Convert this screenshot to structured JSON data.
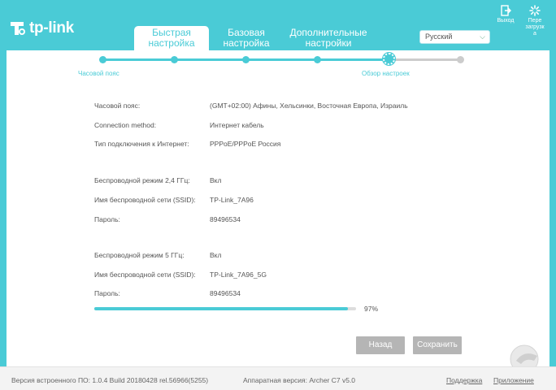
{
  "header": {
    "brand": "tp-link",
    "tabs": [
      {
        "label_line1": "Быстрая",
        "label_line2": "настройка",
        "active": true
      },
      {
        "label_line1": "Базовая",
        "label_line2": "настройка",
        "active": false
      },
      {
        "label_line1": "Дополнительные",
        "label_line2": "настройки",
        "active": false
      }
    ],
    "language": "Русский",
    "logout_label": "Выход",
    "reboot_label_1": "Пере",
    "reboot_label_2": "загрузк",
    "reboot_label_3": "а"
  },
  "wizard": {
    "step_label_first": "Часовой пояс",
    "step_label_current": "Обзор настроек",
    "steps_total": 6,
    "current_step": 5
  },
  "summary": {
    "rows": [
      {
        "label": "Часовой пояс:",
        "value": "(GMT+02:00) Афины, Хельсинки, Восточная Европа, Израиль"
      },
      {
        "label": "Connection method:",
        "value": "Интернет кабель"
      },
      {
        "label": "Тип подключения к Интернет:",
        "value": "PPPoE/PPPoE Россия"
      },
      {
        "label": "Беспроводной режим 2,4 ГГц:",
        "value": "Вкл"
      },
      {
        "label": "Имя беспроводной сети (SSID):",
        "value": "TP-Link_7A96"
      },
      {
        "label": "Пароль:",
        "value": "89496534"
      },
      {
        "label": "Беспроводной режим 5 ГГц:",
        "value": "Вкл"
      },
      {
        "label": "Имя беспроводной сети (SSID):",
        "value": "TP-Link_7A96_5G"
      },
      {
        "label": "Пароль:",
        "value": "89496534"
      }
    ]
  },
  "progress": {
    "value": 0.97,
    "label": "97%"
  },
  "buttons": {
    "back": "Назад",
    "save": "Сохранить"
  },
  "footer": {
    "firmware": "Версия встроенного ПО: 1.0.4 Build 20180428 rel.56966(5255)",
    "hardware": "Аппаратная версия: Archer C7 v5.0",
    "support": "Поддержка",
    "app": "Приложение"
  },
  "colors": {
    "accent": "#4acbd6",
    "button": "#b5b5b5"
  }
}
